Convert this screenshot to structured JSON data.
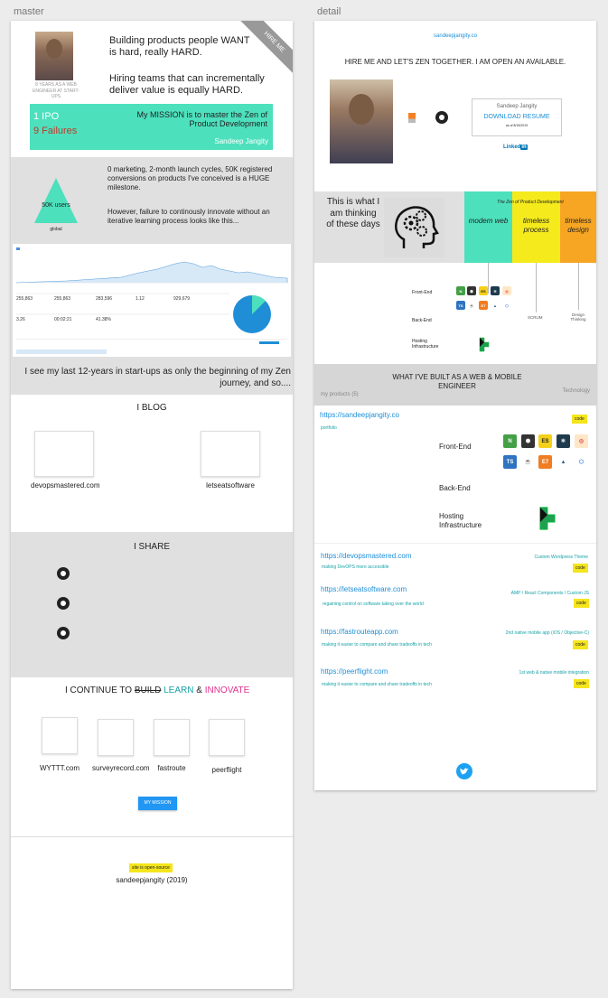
{
  "frames": {
    "master": "master",
    "detail": "detail"
  },
  "master": {
    "hero": {
      "hire_ribbon": "HIRE ME",
      "avatar_caption": "8 YEARS AS A WEB ENGINEER AT START-UPS",
      "headline1": "Building products people WANT is hard, really HARD.",
      "headline2": "Hiring teams that can incrementally deliver value is equally HARD.",
      "mission_ipo": "1 IPO",
      "mission_failures": "9 Failures",
      "mission_text": "My MISSION is to master the Zen of Product Development",
      "mission_author": "Sandeep Jangity"
    },
    "stats": {
      "triangle_value": "50K users",
      "triangle_caption": "global",
      "text1": "0 marketing, 2-month launch cycles, 50K registered conversions on products I've conceived is a HUGE milestone.",
      "text2": "However, failure to continously innovate without an iterative learning process looks like this...",
      "analytics_values": [
        "255,863",
        "255,863",
        "283,596",
        "1.12",
        "929,679",
        "3.26",
        "00:02:21",
        "41.38%"
      ]
    },
    "journey": "I see my last 12-years in start-ups as only the beginning of my Zen journey, and so....",
    "blog": {
      "title": "I BLOG",
      "items": [
        "devopsmastered.com",
        "letseatsoftware"
      ]
    },
    "share": {
      "title": "I SHARE"
    },
    "continue": {
      "prefix": "I CONTINUE TO",
      "build": "BUILD",
      "learn": "LEARN",
      "amp": "&",
      "innovate": "INNOVATE",
      "items": [
        "WYTTT.com",
        "surveyrecord.com",
        "fastroute",
        "peerflight"
      ],
      "mission_button": "MY MISSION"
    },
    "footer": {
      "badge": "site is open-source",
      "copyright": "sandeepjangity (2019)"
    }
  },
  "detail": {
    "site_link": "sandeepjangity.co",
    "headline": "HIRE ME AND LET'S ZEN TOGETHER. I AM OPEN AN AVAILABLE.",
    "resume": {
      "name": "Sandeep Jangity",
      "download": "DOWNLOAD RESUME",
      "date": "as of 8/15/2019"
    },
    "linkedin": "Linked",
    "linkedin_in": "in",
    "thinking": {
      "text": "This is what I am thinking of these days",
      "zen_title": "The Zen of Product Development",
      "col1": "modem web",
      "col2": "timeless process",
      "col3": "timeless design",
      "colors": {
        "col1": "#4de0bd",
        "col2": "#f5ea1c",
        "col3": "#f6a623"
      }
    },
    "stack": {
      "front": "Front-End",
      "back": "Back-End",
      "hosting": "Hosting Infrastructure",
      "scrum": "SCRUM",
      "design": "Design Thinking"
    },
    "built": {
      "title": "WHAT I'VE BUILT AS A WEB & MOBILE ENGINEER",
      "my_products": "my products (5)",
      "technology": "Technology",
      "main_project": {
        "url": "https://sandeepjangity.co",
        "portfolio": "portfolio",
        "code": "code",
        "front": "Front-End",
        "back": "Back-End",
        "hosting": "Hosting Infrastructure"
      },
      "projects": [
        {
          "url": "https://devopsmastered.com",
          "desc": "making DevOPS more accessible",
          "tech": "Custom Wordpress Theme",
          "code": "code"
        },
        {
          "url": "https://letseatsoftware.com",
          "desc": "regaining control on software taking over the world",
          "tech": "AMP / React Components / Custom JS",
          "code": "code"
        },
        {
          "url": "https://fastrouteapp.com",
          "desc": "making it easier to compare and share tradeoffs in tech",
          "tech": "2nd native mobile app (iOS / Objective-C)",
          "code": "code"
        },
        {
          "url": "https://peerflight.com",
          "desc": "making it easier to compare and share tradeoffs in tech",
          "tech": "1st web & native mobile integration",
          "code": "code"
        }
      ]
    }
  }
}
